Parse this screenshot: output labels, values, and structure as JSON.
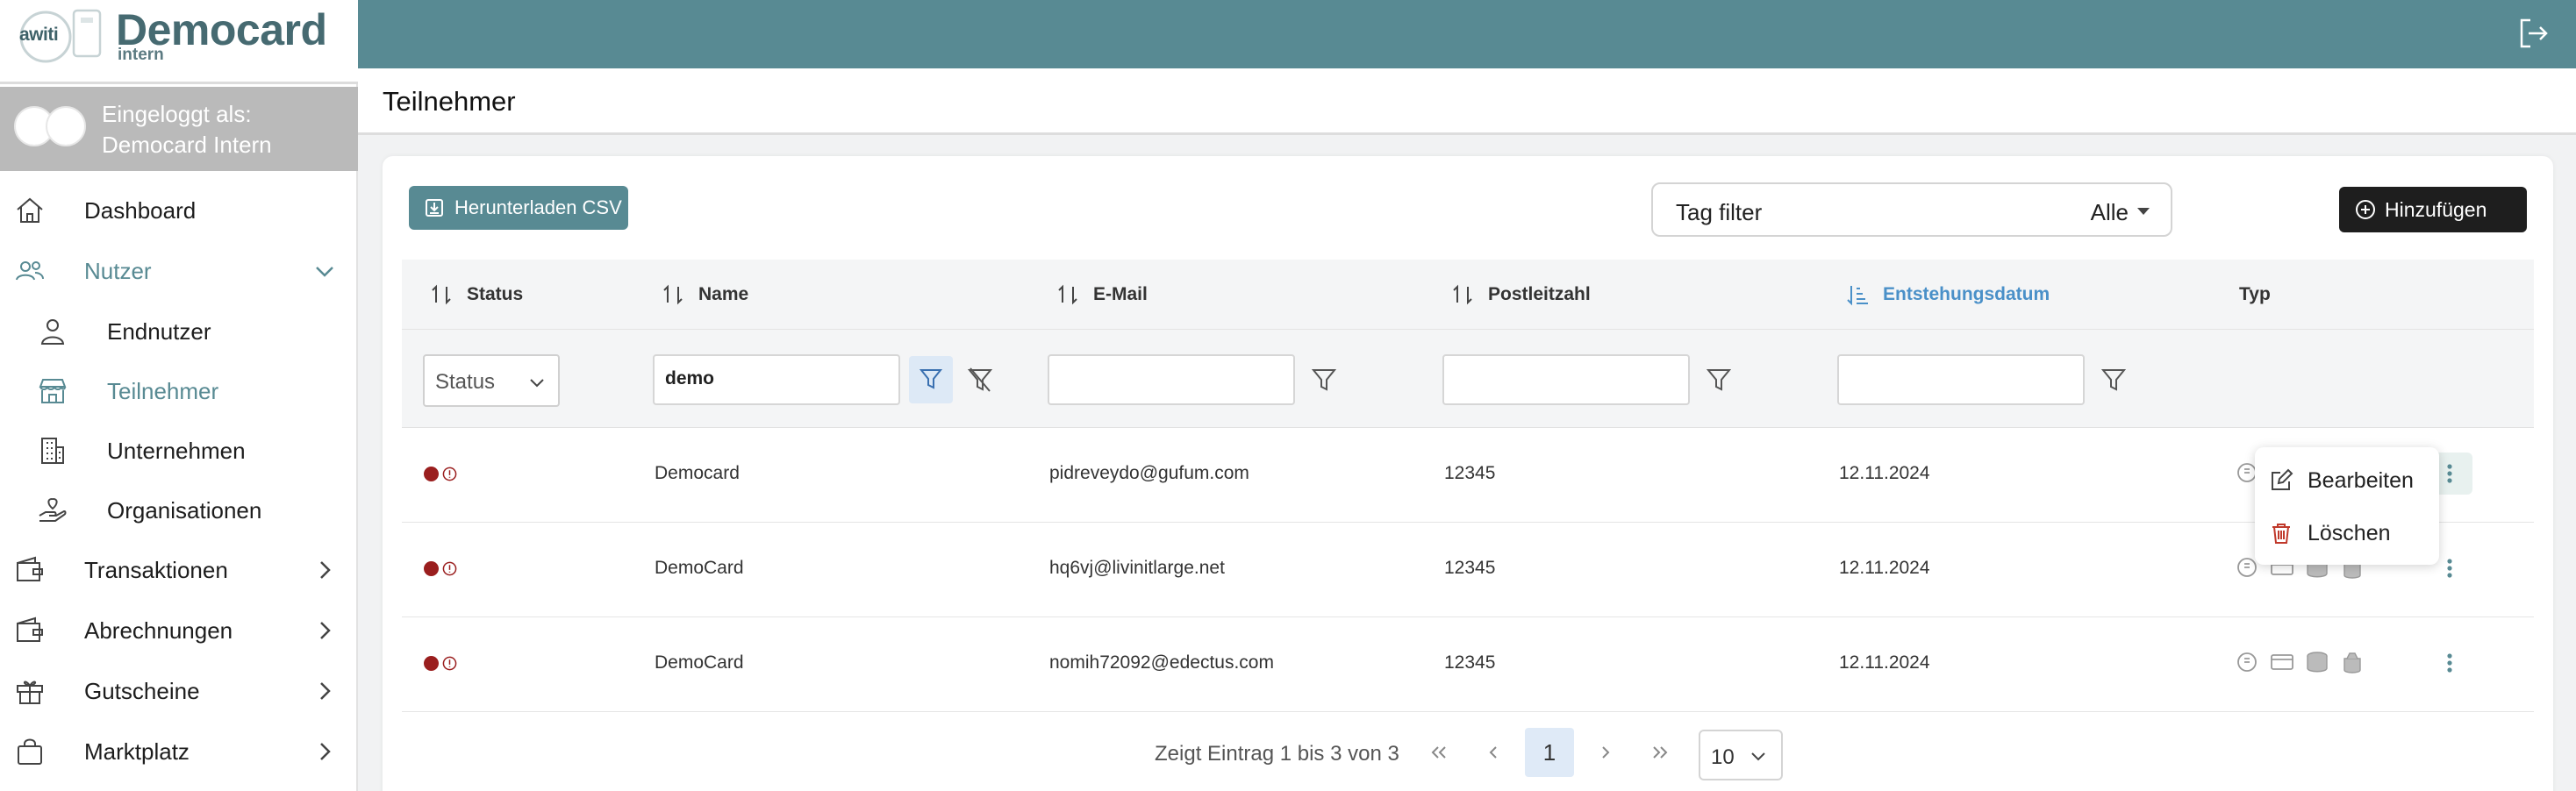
{
  "brand": {
    "logo_word": "awiti",
    "title": "Democard",
    "subtitle": "intern"
  },
  "user": {
    "label_line1": "Eingeloggt als:",
    "label_line2": "Democard Intern"
  },
  "sidebar": {
    "items": [
      {
        "label": "Dashboard",
        "icon": "home-icon"
      },
      {
        "label": "Nutzer",
        "icon": "users-icon",
        "expanded": true
      },
      {
        "label": "Endnutzer",
        "icon": "user-icon"
      },
      {
        "label": "Teilnehmer",
        "icon": "store-icon",
        "active": true
      },
      {
        "label": "Unternehmen",
        "icon": "building-icon"
      },
      {
        "label": "Organisationen",
        "icon": "hand-heart-icon"
      },
      {
        "label": "Transaktionen",
        "icon": "wallet-icon"
      },
      {
        "label": "Abrechnungen",
        "icon": "wallet-icon"
      },
      {
        "label": "Gutscheine",
        "icon": "gift-icon"
      },
      {
        "label": "Marktplatz",
        "icon": "bag-icon"
      }
    ]
  },
  "page": {
    "title": "Teilnehmer"
  },
  "toolbar": {
    "csv_label": "Herunterladen CSV",
    "tag_filter_label": "Tag filter",
    "tag_filter_value": "Alle",
    "add_label": "Hinzufügen"
  },
  "table": {
    "columns": [
      "Status",
      "Name",
      "E-Mail",
      "Postleitzahl",
      "Entstehungsdatum",
      "Typ"
    ],
    "sorted_column": "Entstehungsdatum",
    "filters": {
      "status_placeholder": "Status",
      "name": "demo",
      "email": "",
      "postleitzahl": "",
      "entstehungsdatum": ""
    },
    "rows": [
      {
        "name": "Democard",
        "email": "pidreveydo@gufum.com",
        "plz": "12345",
        "date": "12.11.2024"
      },
      {
        "name": "DemoCard",
        "email": "hq6vj@livinitlarge.net",
        "plz": "12345",
        "date": "12.11.2024"
      },
      {
        "name": "DemoCard",
        "email": "nomih72092@edectus.com",
        "plz": "12345",
        "date": "12.11.2024"
      }
    ]
  },
  "context_menu": {
    "edit_label": "Bearbeiten",
    "delete_label": "Löschen"
  },
  "pagination": {
    "info": "Zeigt Eintrag 1 bis 3 von 3",
    "current_page": "1",
    "page_size": "10"
  },
  "colors": {
    "primary": "#588a93",
    "status_red": "#9a1e1e",
    "sort_active": "#4a90c8",
    "delete_red": "#c0392b"
  }
}
